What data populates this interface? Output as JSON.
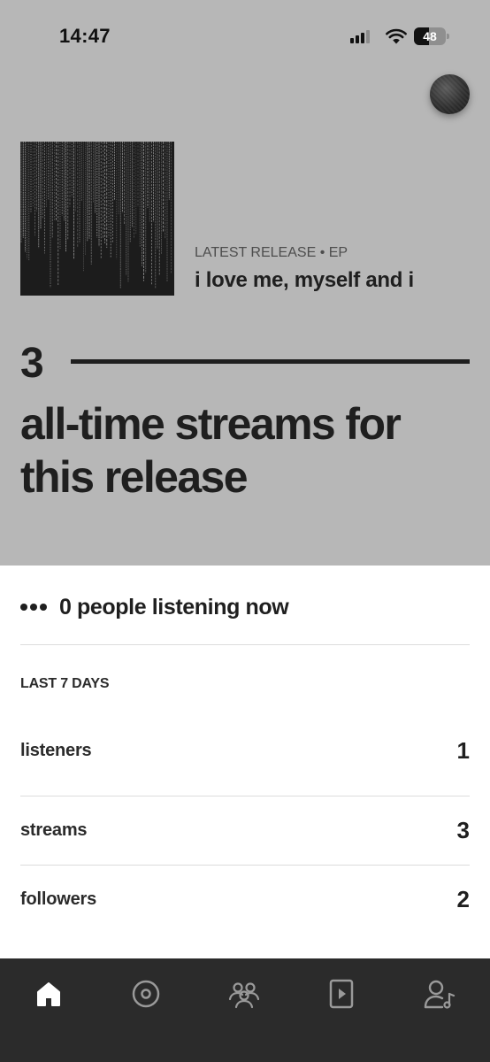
{
  "status_bar": {
    "time": "14:47",
    "battery": "48",
    "battery_level": 0.48
  },
  "release": {
    "meta": "LATEST RELEASE • EP",
    "title": "i love me, myself and i",
    "all_time_streams": "3",
    "caption": "all-time streams for this release"
  },
  "live": {
    "text": "0 people listening now"
  },
  "last7": {
    "label": "LAST 7 DAYS",
    "stats": [
      {
        "label": "listeners",
        "value": "1"
      },
      {
        "label": "streams",
        "value": "3"
      },
      {
        "label": "followers",
        "value": "2"
      }
    ]
  },
  "tabbar": {
    "tabs": [
      {
        "icon": "home-icon",
        "active": true
      },
      {
        "icon": "music-disc-icon",
        "active": false
      },
      {
        "icon": "audience-icon",
        "active": false
      },
      {
        "icon": "video-play-icon",
        "active": false
      },
      {
        "icon": "artist-profile-icon",
        "active": false
      }
    ]
  },
  "colors": {
    "hero_bg": "#b7b7b7",
    "text": "#1f1f1f",
    "tabbar_bg": "#2b2b2b",
    "tab_active": "#ffffff",
    "tab_inactive": "#9a9a9a"
  }
}
